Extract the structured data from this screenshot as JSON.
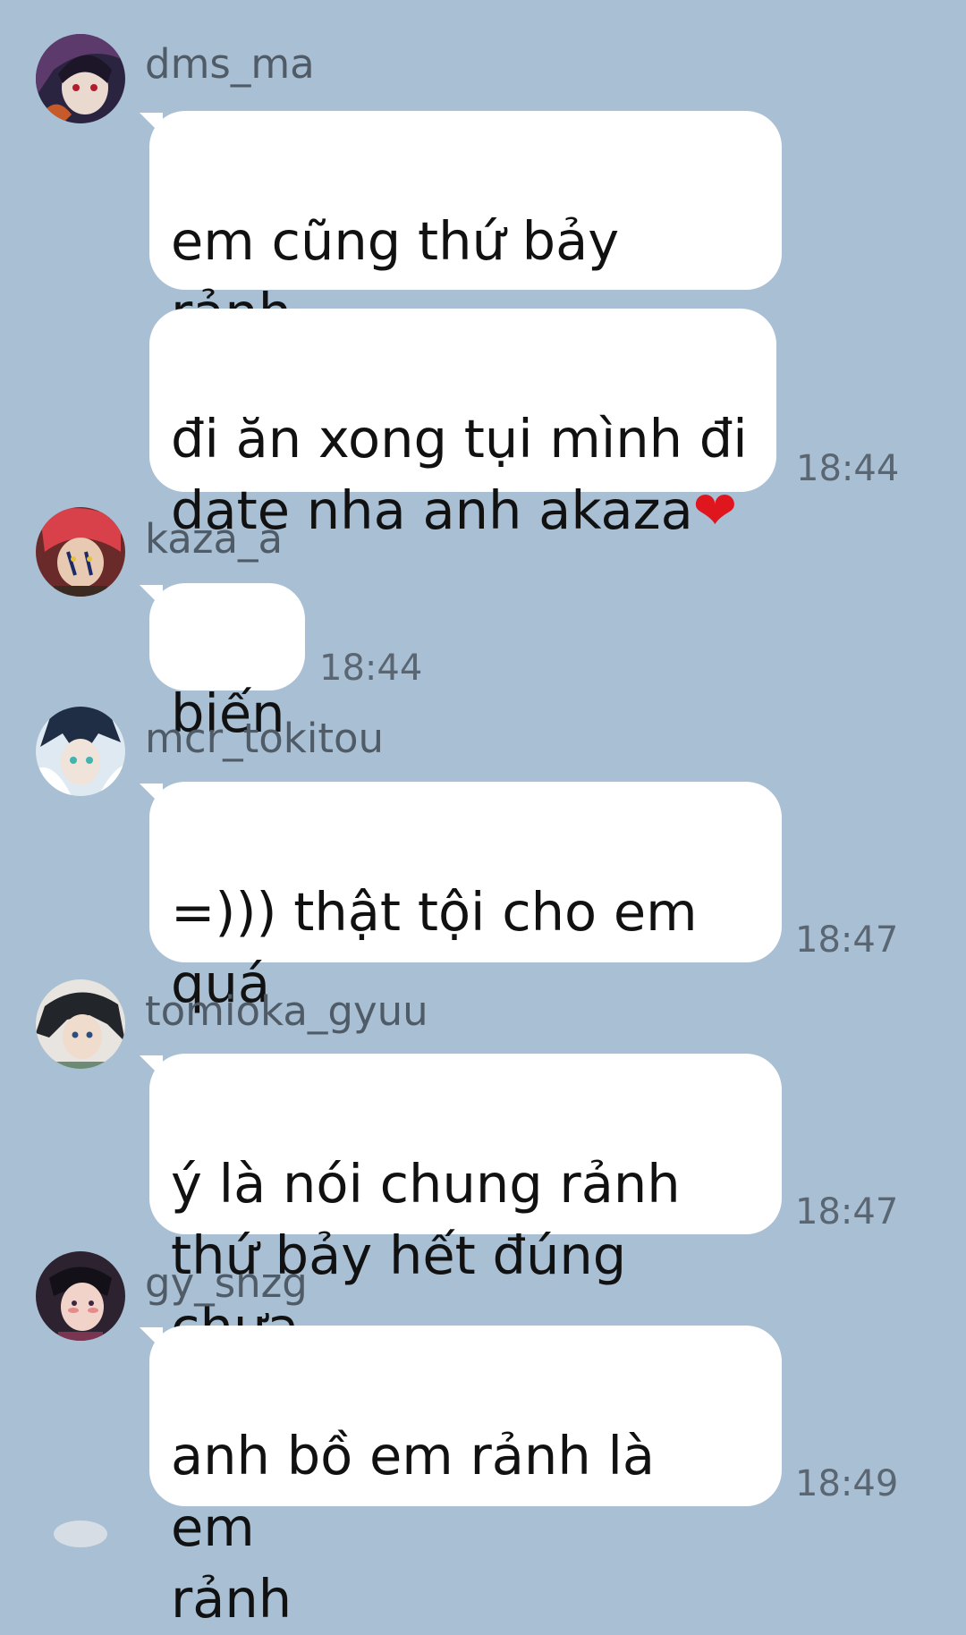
{
  "messages": [
    {
      "user": "dms_ma",
      "bubbles": [
        {
          "text": "em cũng thứ bảy rảnh",
          "heart": "❤"
        },
        {
          "text": "đi ăn xong tụi mình đi\ndate nha anh akaza",
          "heart": "❤"
        }
      ],
      "time": "18:44"
    },
    {
      "user": "kaza_a",
      "bubbles": [
        {
          "text": "biến"
        }
      ],
      "time": "18:44"
    },
    {
      "user": "mcr_tokitou",
      "bubbles": [
        {
          "text": "=))) thật tội cho em\nquá"
        }
      ],
      "time": "18:47"
    },
    {
      "user": "tomioka_gyuu",
      "bubbles": [
        {
          "text": "ý là nói chung rảnh\nthứ bảy hết đúng chưa"
        }
      ],
      "time": "18:47"
    },
    {
      "user": "gy_snzg",
      "bubbles": [
        {
          "text": "anh bồ em rảnh là em\nrảnh"
        }
      ],
      "time": "18:49"
    }
  ],
  "colors": {
    "background": "#a9bfd4",
    "bubble": "#ffffff",
    "username": "#4f5b66",
    "timestamp": "#5a6672",
    "heart": "#e0161e"
  },
  "icons": {
    "avatars": [
      "avatar-dms-ma-icon",
      "avatar-kaza-a-icon",
      "avatar-mcr-tokitou-icon",
      "avatar-tomioka-gyuu-icon",
      "avatar-gy-snzg-icon"
    ],
    "heart": "heart-emoji-icon"
  }
}
